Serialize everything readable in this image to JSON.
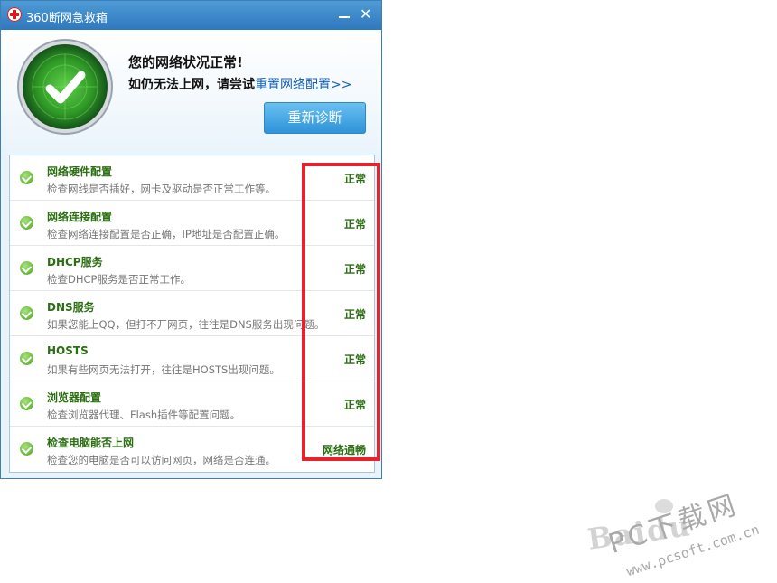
{
  "window": {
    "title": "360断网急救箱"
  },
  "header": {
    "status_title": "您的网络状况正常!",
    "hint_prefix": "如仍无法上网，请尝试",
    "hint_link": "重置网络配置>>",
    "rediagnose_label": "重新诊断"
  },
  "checks": [
    {
      "title": "网络硬件配置",
      "desc": "检查网线是否插好，网卡及驱动是否正常工作等。",
      "status": "正常"
    },
    {
      "title": "网络连接配置",
      "desc": "检查网络连接配置是否正确，IP地址是否配置正确。",
      "status": "正常"
    },
    {
      "title": "DHCP服务",
      "desc": "检查DHCP服务是否正常工作。",
      "status": "正常"
    },
    {
      "title": "DNS服务",
      "desc": "如果您能上QQ，但打不开网页，往往是DNS服务出现问题。",
      "status": "正常"
    },
    {
      "title": "HOSTS",
      "desc": "如果有些网页无法打开，往往是HOSTS出现问题。",
      "status": "正常"
    },
    {
      "title": "浏览器配置",
      "desc": "检查浏览器代理、Flash插件等配置问题。",
      "status": "正常"
    },
    {
      "title": "检查电脑能否上网",
      "desc": "检查您的电脑是否可以访问网页，网络是否连通。",
      "status": "网络通畅"
    }
  ],
  "watermark": {
    "brand": "Baidu",
    "pc": "PC下载网",
    "url": "www.pcsoft.com.cn"
  },
  "colors": {
    "status_green": "#2b6f12",
    "highlight_red": "#e8222c",
    "titlebar_blue": "#2f78bd"
  }
}
